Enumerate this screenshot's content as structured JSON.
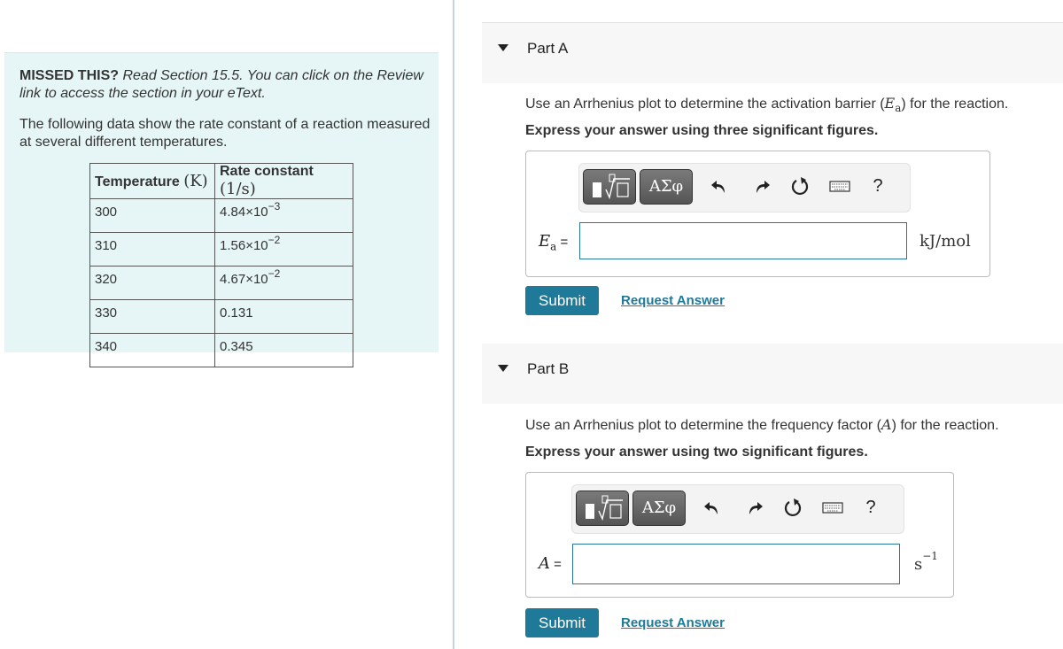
{
  "left_panel": {
    "missed_label": "MISSED THIS?",
    "missed_text": "Read Section 15.5. You can click on the Review link to access the section in your eText.",
    "intro": "The following data show the rate constant of a reaction measured at several different temperatures.",
    "table": {
      "headers": [
        {
          "label": "Temperature",
          "unit": "(K)"
        },
        {
          "label": "Rate constant",
          "unit": "(1/s)"
        }
      ],
      "rows": [
        {
          "temperature": "300",
          "k_mantissa": "4.84×10",
          "k_exp": "−3"
        },
        {
          "temperature": "310",
          "k_mantissa": "1.56×10",
          "k_exp": "−2"
        },
        {
          "temperature": "320",
          "k_mantissa": "4.67×10",
          "k_exp": "−2"
        },
        {
          "temperature": "330",
          "k_mantissa": "0.131",
          "k_exp": ""
        },
        {
          "temperature": "340",
          "k_mantissa": "0.345",
          "k_exp": ""
        }
      ]
    }
  },
  "toolbar": {
    "greek_label": "ΑΣφ",
    "icons": [
      "templates-icon",
      "greek-letters-icon",
      "undo-icon",
      "redo-icon",
      "reset-icon",
      "keyboard-icon",
      "help-icon"
    ],
    "undo_glyph": "↶",
    "redo_glyph": "↷",
    "reset_glyph": "↻",
    "keyboard_glyph": "⌨",
    "help_glyph": "?"
  },
  "parts": [
    {
      "title": "Part A",
      "question_pre": "Use an Arrhenius plot to determine the activation barrier (",
      "question_var": "E",
      "question_sub": "a",
      "question_post": ") for the reaction.",
      "instruction": "Express your answer using three significant figures.",
      "answer_label_var": "E",
      "answer_label_sub": "a",
      "answer_label_eq": " =",
      "answer_value": "",
      "unit": "kJ/mol",
      "unit_sup": "",
      "submit_label": "Submit",
      "request_label": "Request Answer"
    },
    {
      "title": "Part B",
      "question_pre": "Use an Arrhenius plot to determine the frequency factor (",
      "question_var": "A",
      "question_sub": "",
      "question_post": ") for the reaction.",
      "instruction": "Express your answer using two significant figures.",
      "answer_label_var": "A",
      "answer_label_sub": "",
      "answer_label_eq": " =",
      "answer_value": "",
      "unit": "s",
      "unit_sup": "−1",
      "submit_label": "Submit",
      "request_label": "Request Answer"
    }
  ],
  "colors": {
    "accent": "#1f7a99",
    "panel_bg": "#e6f6f7",
    "header_bg": "#f7f7f7"
  }
}
